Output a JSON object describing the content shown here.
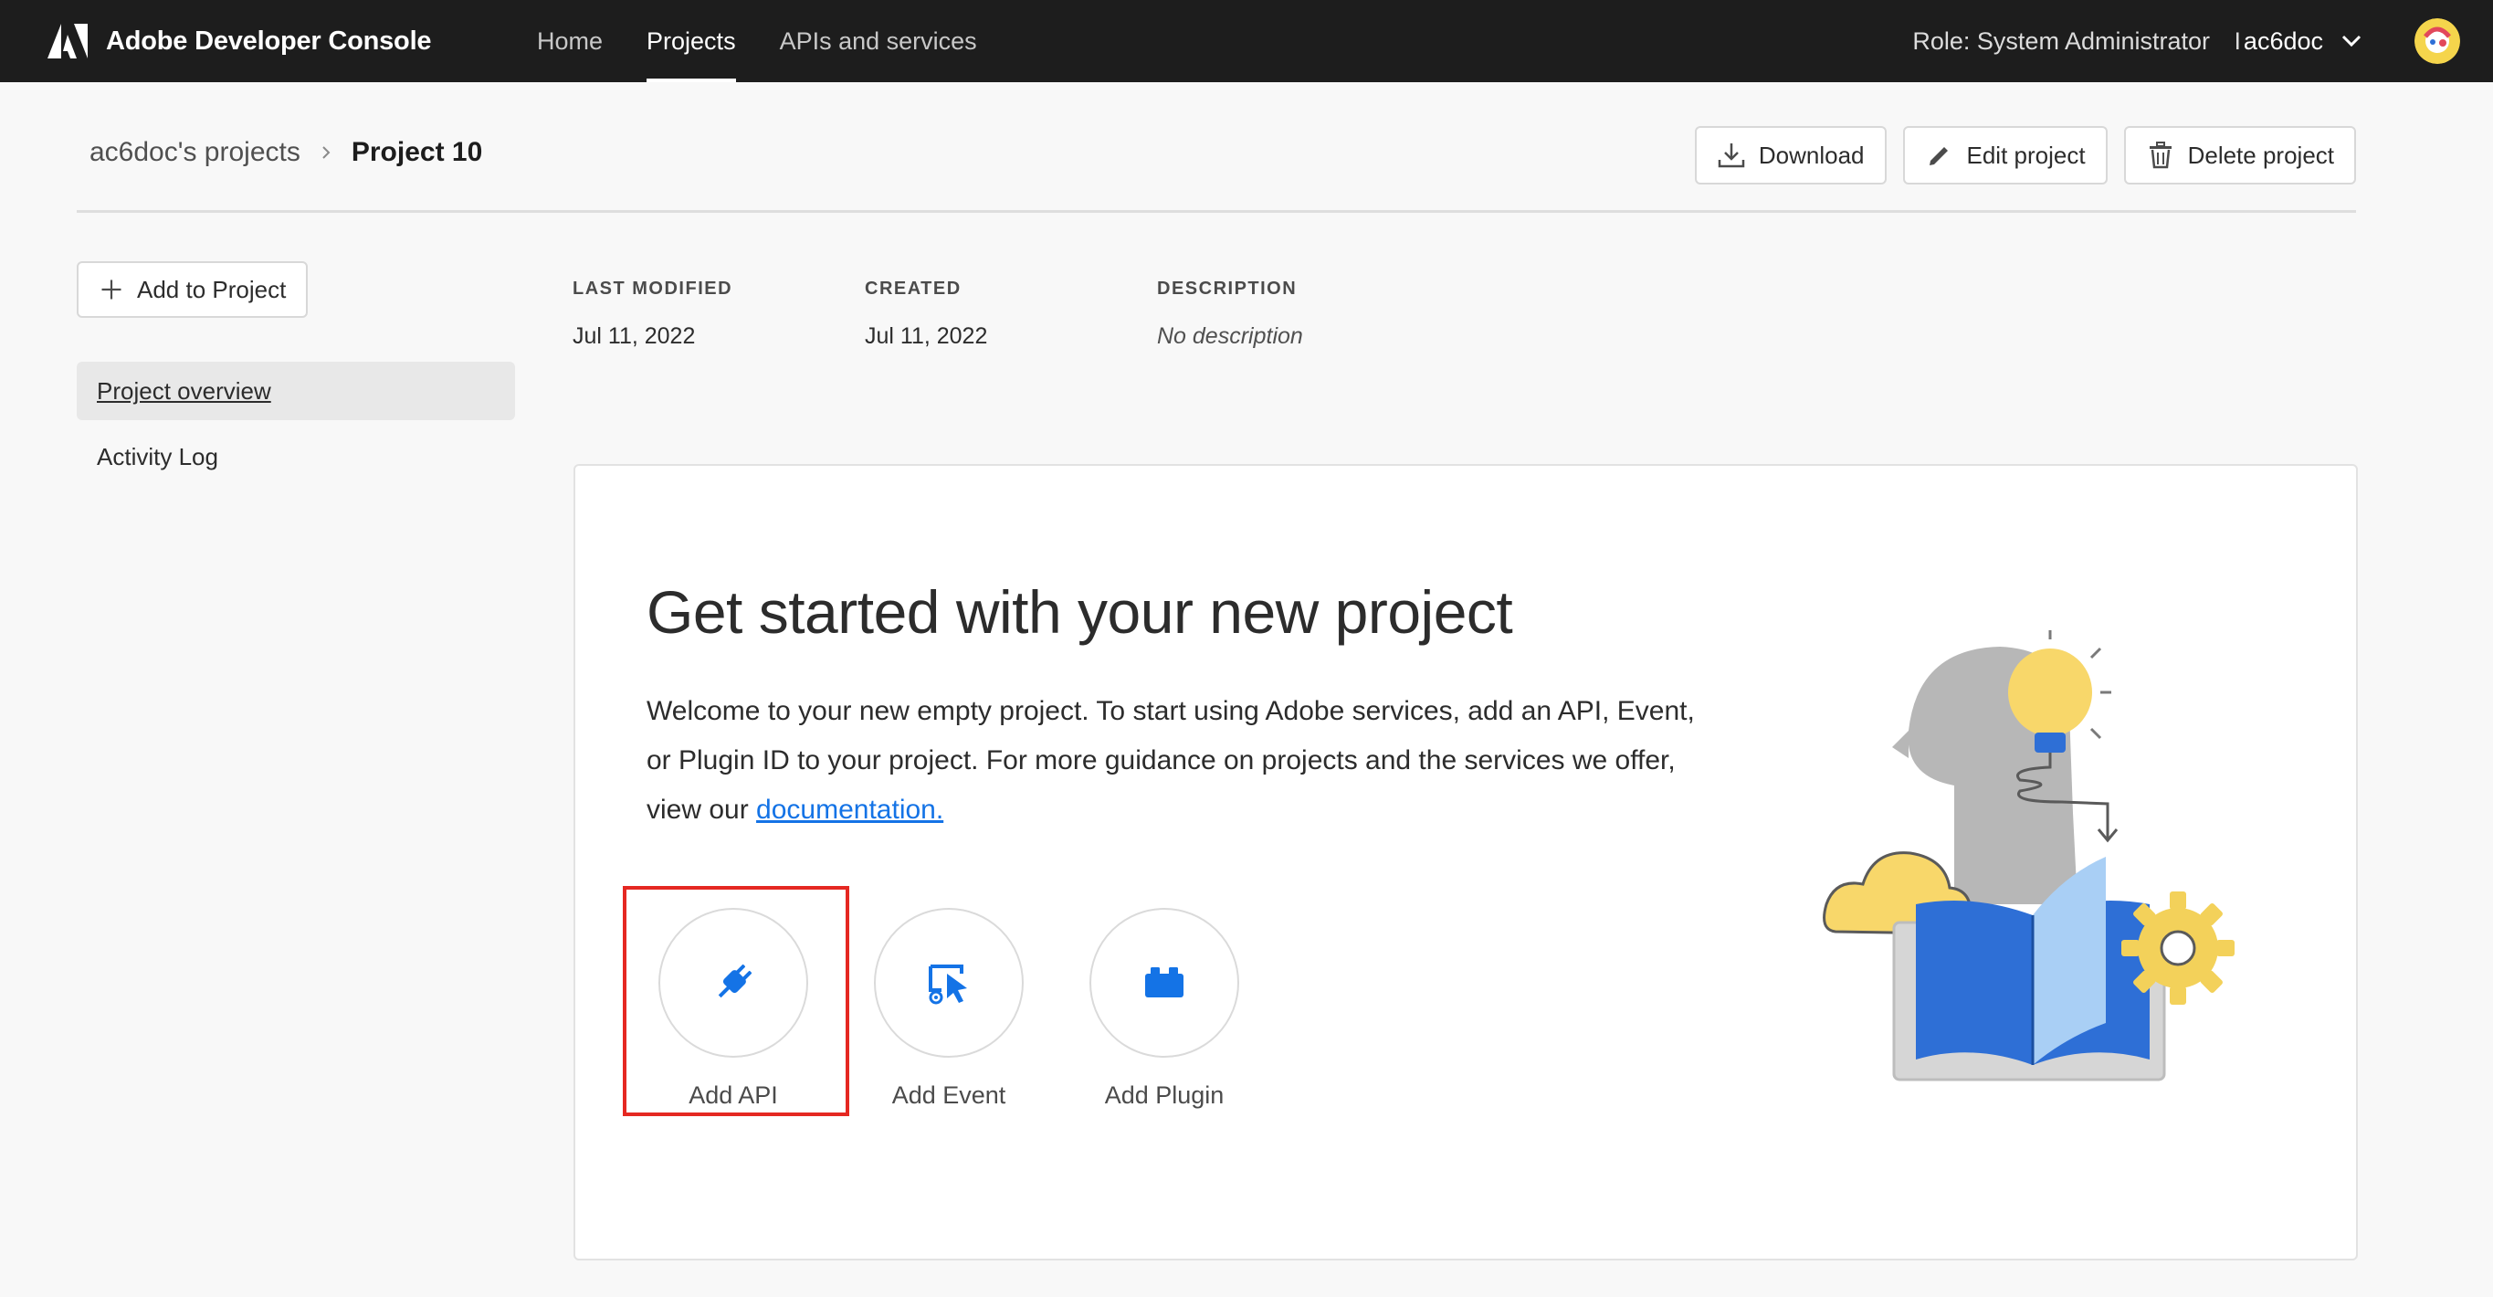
{
  "app": {
    "brand": "Adobe Developer Console"
  },
  "nav": {
    "items": [
      {
        "label": "Home",
        "active": false
      },
      {
        "label": "Projects",
        "active": true
      },
      {
        "label": "APIs and services",
        "active": false
      }
    ]
  },
  "user": {
    "role": "Role: System Administrator",
    "separator": "I",
    "name": "ac6doc"
  },
  "breadcrumb": {
    "parent": "ac6doc's projects",
    "current": "Project 10"
  },
  "actions": {
    "download": "Download",
    "edit": "Edit project",
    "delete": "Delete project"
  },
  "sidebar": {
    "add_to_project": "Add to Project",
    "items": [
      {
        "label": "Project overview",
        "active": true
      },
      {
        "label": "Activity Log",
        "active": false
      }
    ]
  },
  "meta": {
    "last_modified_label": "LAST MODIFIED",
    "last_modified": "Jul 11, 2022",
    "created_label": "CREATED",
    "created": "Jul 11, 2022",
    "description_label": "DESCRIPTION",
    "description": "No description"
  },
  "card": {
    "title": "Get started with your new project",
    "body": "Welcome to your new empty project. To start using Adobe services, add an API, Event, or Plugin ID to your project. For more guidance on projects and the services we offer, view our ",
    "link": "documentation."
  },
  "quick_actions": [
    {
      "label": "Add API",
      "icon": "plug-icon"
    },
    {
      "label": "Add Event",
      "icon": "event-icon"
    },
    {
      "label": "Add Plugin",
      "icon": "plugin-icon"
    }
  ],
  "colors": {
    "topbar": "#1d1d1d",
    "accent": "#1473e6",
    "highlight": "#e52822"
  }
}
